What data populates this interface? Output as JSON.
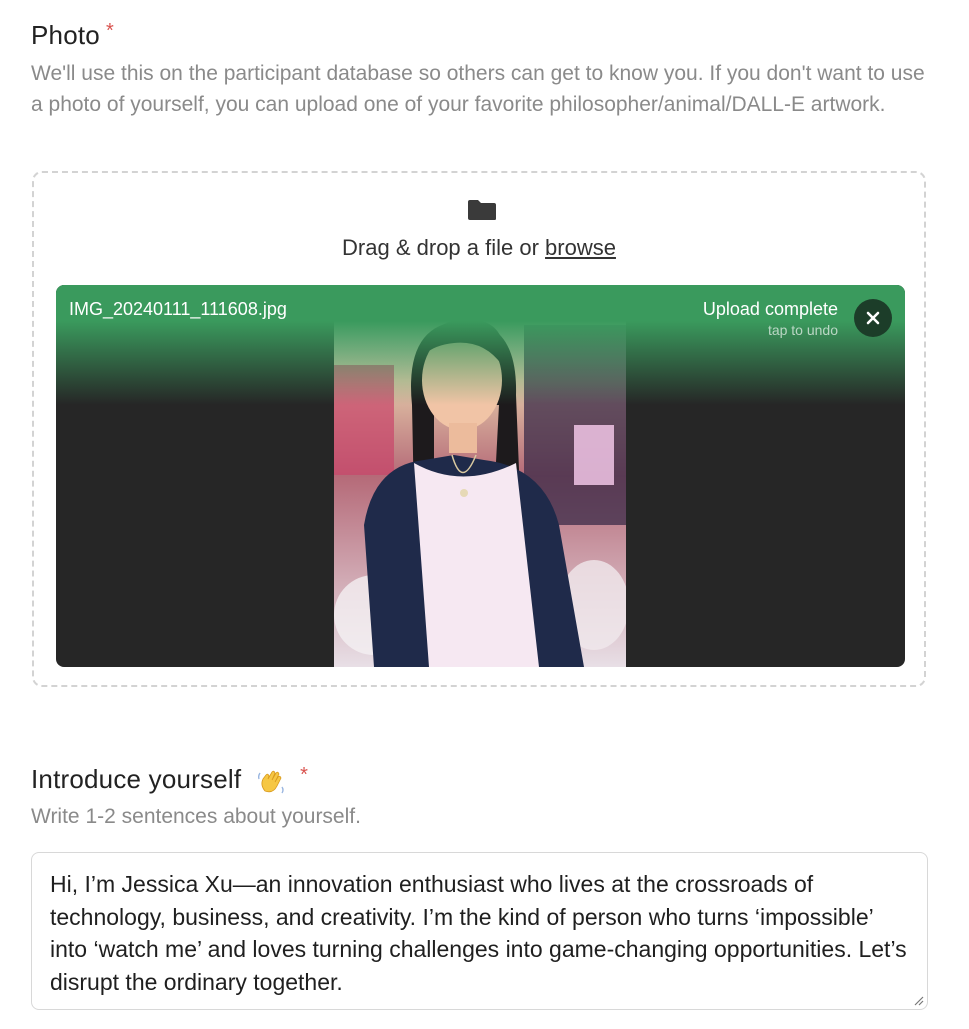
{
  "photo_field": {
    "label": "Photo",
    "required_mark": "*",
    "help": "We'll use this on the participant database so others can get to know you. If you don't want to use a photo of yourself, you can upload one of your favorite philosopher/animal/DALL-E artwork.",
    "dropzone": {
      "icon": "folder-icon",
      "text_prefix": "Drag & drop a file or ",
      "browse_label": "browse"
    },
    "upload": {
      "file_name": "IMG_20240111_111608.jpg",
      "status": "Upload complete",
      "status_hint": "tap to undo",
      "undo_icon": "close-icon",
      "accent_color": "#3a9a5d",
      "undo_button_color": "#1c3d29"
    }
  },
  "intro_field": {
    "label": "Introduce yourself",
    "emoji_icon": "waving-hand-icon",
    "required_mark": "*",
    "help": "Write 1-2 sentences about yourself.",
    "value": "Hi, I’m Jessica Xu—an innovation enthusiast who lives at the crossroads of technology, business, and creativity. I’m the kind of person who turns ‘impossible’ into ‘watch me’ and loves turning challenges into game-changing opportunities. Let’s disrupt the ordinary together."
  },
  "colors": {
    "required": "#d9534f",
    "help_text": "#8a8a8a"
  }
}
